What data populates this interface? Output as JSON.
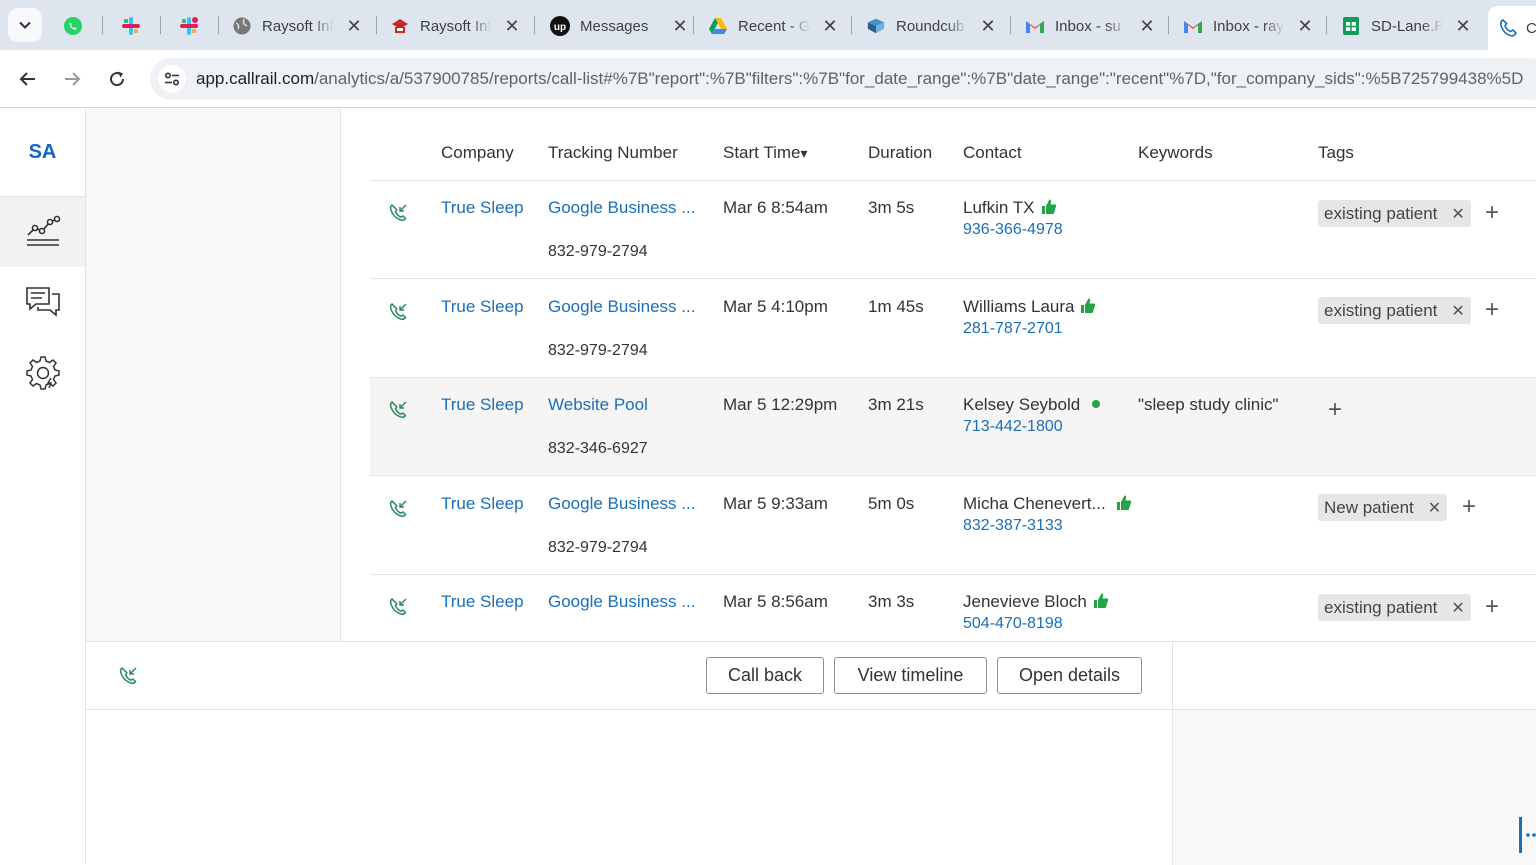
{
  "browser": {
    "tabs": [
      {
        "title": "",
        "icon": "whatsapp-icon",
        "color": "#25d366"
      },
      {
        "title": "",
        "icon": "slack-icon",
        "color": "#e01e5a"
      },
      {
        "title": "",
        "icon": "slack-icon",
        "color": "#e01e5a"
      },
      {
        "title": "Raysoft Inf",
        "icon": "globe-icon"
      },
      {
        "title": "Raysoft Inf",
        "icon": "raysoft-icon"
      },
      {
        "title": "Messages",
        "icon": "upwork-icon"
      },
      {
        "title": "Recent - G",
        "icon": "google-drive-icon"
      },
      {
        "title": "Roundcub",
        "icon": "roundcube-icon"
      },
      {
        "title": "Inbox - su",
        "icon": "gmail-icon"
      },
      {
        "title": "Inbox - ray",
        "icon": "gmail-icon"
      },
      {
        "title": "SD-Lane.R",
        "icon": "google-sheets-icon"
      },
      {
        "title": "C",
        "icon": "callrail-icon"
      }
    ],
    "url_domain": "app.callrail.com",
    "url_path": "/analytics/a/537900785/reports/call-list#%7B\"report\":%7B\"filters\":%7B\"for_date_range\":%7B\"date_range\":\"recent\"%7D,\"for_company_sids\":%5B725799438%5D"
  },
  "app": {
    "brand": "SA",
    "nav": [
      "analytics-icon",
      "messages-icon",
      "settings-icon"
    ]
  },
  "table": {
    "headers": {
      "company": "Company",
      "tracking_number": "Tracking Number",
      "start_time": "Start Time",
      "sort_indicator": "▾",
      "duration": "Duration",
      "contact": "Contact",
      "keywords": "Keywords",
      "tags": "Tags"
    },
    "rows": [
      {
        "company": "True Sleep",
        "tracking_source": "Google Business ...",
        "tracking_phone": "832-979-2794",
        "start_time": "Mar 6 8:54am",
        "duration": "3m 5s",
        "contact_name": "Lufkin TX",
        "contact_phone": "936-366-4978",
        "indicator": "thumbs-up",
        "keywords": "",
        "tag": "existing patient",
        "highlight": false
      },
      {
        "company": "True Sleep",
        "tracking_source": "Google Business ...",
        "tracking_phone": "832-979-2794",
        "start_time": "Mar 5 4:10pm",
        "duration": "1m 45s",
        "contact_name": "Williams Laura",
        "contact_phone": "281-787-2701",
        "indicator": "thumbs-up",
        "keywords": "",
        "tag": "existing patient",
        "highlight": false
      },
      {
        "company": "True Sleep",
        "tracking_source": "Website Pool",
        "tracking_phone": "832-346-6927",
        "start_time": "Mar 5 12:29pm",
        "duration": "3m 21s",
        "contact_name": "Kelsey Seybold",
        "contact_phone": "713-442-1800",
        "indicator": "dot",
        "keywords": "\"sleep study clinic\"",
        "tag": "",
        "highlight": true
      },
      {
        "company": "True Sleep",
        "tracking_source": "Google Business ...",
        "tracking_phone": "832-979-2794",
        "start_time": "Mar 5 9:33am",
        "duration": "5m 0s",
        "contact_name": "Micha Chenevert...",
        "contact_phone": "832-387-3133",
        "indicator": "thumbs-up",
        "keywords": "",
        "tag": "New patient",
        "highlight": false
      },
      {
        "company": "True Sleep",
        "tracking_source": "Google Business ...",
        "tracking_phone": "",
        "start_time": "Mar 5 8:56am",
        "duration": "3m 3s",
        "contact_name": "Jenevieve Bloch",
        "contact_phone": "504-470-8198",
        "indicator": "thumbs-up",
        "keywords": "",
        "tag": "existing patient",
        "highlight": false
      }
    ]
  },
  "bottom_panel": {
    "call_back": "Call back",
    "view_timeline": "View timeline",
    "open_details": "Open details"
  },
  "colors": {
    "link": "#1b6fb8",
    "brand": "#1565c0",
    "thumb": "#22a447"
  }
}
